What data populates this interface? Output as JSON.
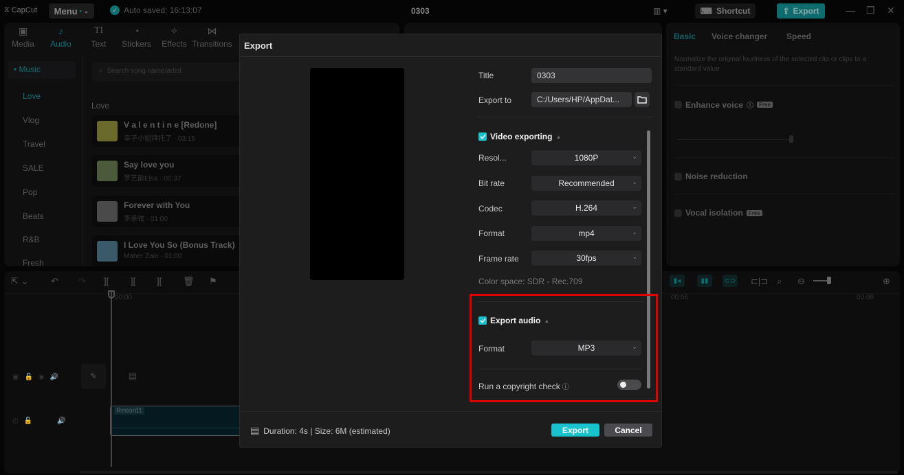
{
  "app": {
    "logo": "CapCut",
    "menu_label": "Menu",
    "autosave": "Auto saved: 16:13:07",
    "project_title": "0303",
    "shortcut_label": "Shortcut",
    "export_label": "Export"
  },
  "toolbar_tabs": [
    {
      "label": "Media",
      "icon": "media-icon"
    },
    {
      "label": "Audio",
      "icon": "audio-icon",
      "active": true
    },
    {
      "label": "Text",
      "icon": "text-icon"
    },
    {
      "label": "Stickers",
      "icon": "stickers-icon"
    },
    {
      "label": "Effects",
      "icon": "effects-icon"
    },
    {
      "label": "Transitions",
      "icon": "transitions-icon"
    }
  ],
  "sidebar": {
    "music_label": "Music",
    "items": [
      "Love",
      "Vlog",
      "Travel",
      "SALE",
      "Pop",
      "Beats",
      "R&B",
      "Fresh"
    ]
  },
  "music": {
    "search_placeholder": "Search song name/artist",
    "list_header": "Love",
    "songs": [
      {
        "title": "V a l e n t i n e [Redone]",
        "meta": "幸子小姐拜托了 · 03:15"
      },
      {
        "title": "Say love you",
        "meta": "罗艺歆Elsa · 00:37"
      },
      {
        "title": "Forever with You",
        "meta": "李承铉 · 01:00"
      },
      {
        "title": "I Love You So (Bonus Track)",
        "meta": "Maher Zain · 01:00"
      }
    ]
  },
  "right_panel": {
    "tabs": [
      "Basic",
      "Voice changer",
      "Speed"
    ],
    "description": "Normalize the original loudness of the selected clip or clips to a standard value",
    "enhance_voice": "Enhance voice",
    "noise_reduction": "Noise reduction",
    "vocal_isolation": "Vocal isolation",
    "free_badge": "Free"
  },
  "timeline": {
    "ruler": [
      "00:00",
      "00:06",
      "00:08"
    ],
    "clip_label": "Record1"
  },
  "export_dialog": {
    "title": "Export",
    "title_label": "Title",
    "title_value": "0303",
    "export_to_label": "Export to",
    "export_to_value": "C:/Users/HP/AppDat...",
    "video_section": "Video exporting",
    "video_enabled": true,
    "fields": [
      {
        "label": "Resol...",
        "value": "1080P"
      },
      {
        "label": "Bit rate",
        "value": "Recommended"
      },
      {
        "label": "Codec",
        "value": "H.264"
      },
      {
        "label": "Format",
        "value": "mp4"
      },
      {
        "label": "Frame rate",
        "value": "30fps"
      }
    ],
    "color_space": "Color space: SDR - Rec.709",
    "audio_section": "Export audio",
    "audio_enabled": true,
    "audio_format_label": "Format",
    "audio_format_value": "MP3",
    "copyright_label": "Run a copyright check",
    "copyright_enabled": false,
    "footer_info": "Duration: 4s | Size: 6M (estimated)",
    "export_button": "Export",
    "cancel_button": "Cancel"
  },
  "colors": {
    "accent": "#19c2cc",
    "highlight_box": "#e00000"
  }
}
